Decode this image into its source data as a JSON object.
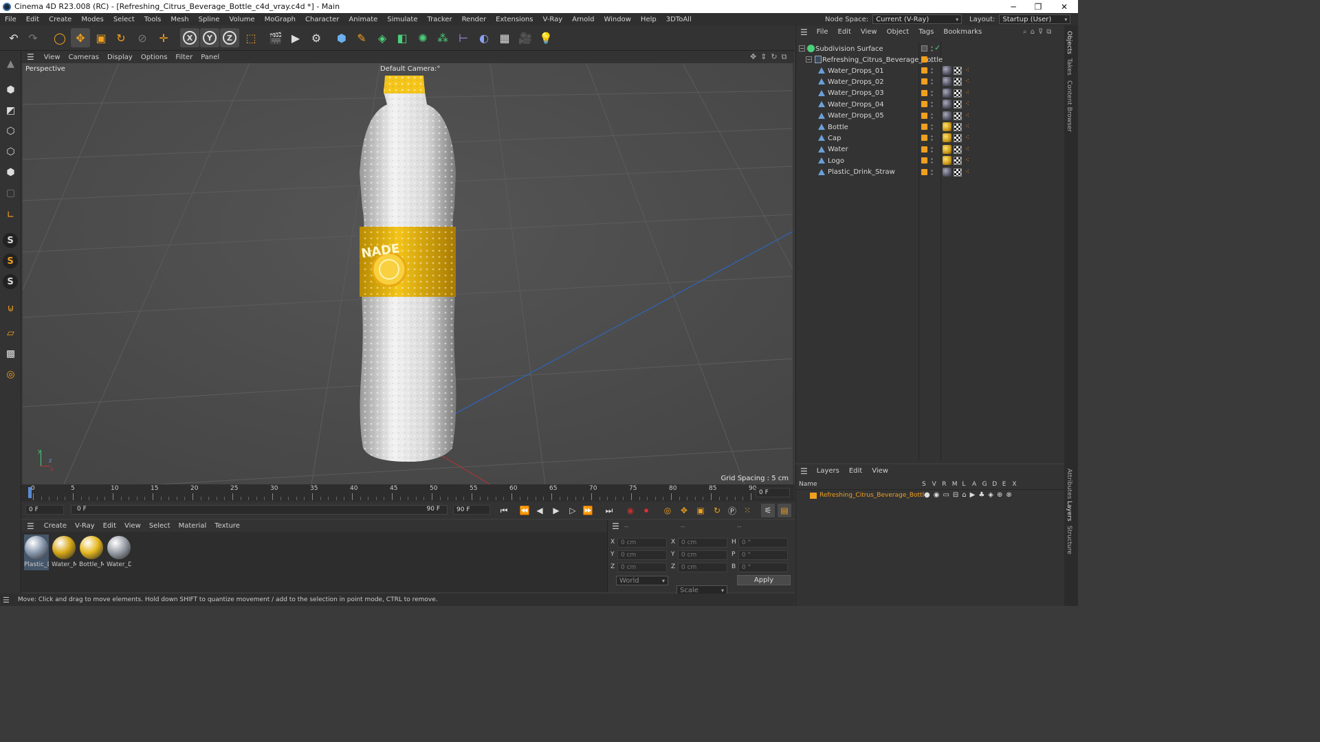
{
  "window": {
    "title": "Cinema 4D R23.008 (RC) - [Refreshing_Citrus_Beverage_Bottle_c4d_vray.c4d *] - Main",
    "minimize": "─",
    "maximize": "❐",
    "close": "✕"
  },
  "menu": [
    "File",
    "Edit",
    "Create",
    "Modes",
    "Select",
    "Tools",
    "Mesh",
    "Spline",
    "Volume",
    "MoGraph",
    "Character",
    "Animate",
    "Simulate",
    "Tracker",
    "Render",
    "Extensions",
    "V-Ray",
    "Arnold",
    "Window",
    "Help",
    "3DToAll"
  ],
  "header": {
    "node_space_label": "Node Space:",
    "node_space_value": "Current (V-Ray)",
    "layout_label": "Layout:",
    "layout_value": "Startup (User)"
  },
  "viewport": {
    "menu": [
      "View",
      "Cameras",
      "Display",
      "Options",
      "Filter",
      "Panel"
    ],
    "view_name": "Perspective",
    "camera": "Default Camera:°",
    "grid_spacing": "Grid Spacing : 5 cm",
    "label_text": "NADE",
    "axis": {
      "y": "y",
      "z": "z",
      "x": "x"
    }
  },
  "timeline": {
    "ticks": [
      "0",
      "5",
      "10",
      "15",
      "20",
      "25",
      "30",
      "35",
      "40",
      "45",
      "50",
      "55",
      "60",
      "65",
      "70",
      "75",
      "80",
      "85",
      "90"
    ],
    "end_field": "0 F"
  },
  "transport": {
    "start": "0 F",
    "range_start": "0 F",
    "range_end": "90 F",
    "end": "90 F"
  },
  "materials": {
    "menu": [
      "Create",
      "V-Ray",
      "Edit",
      "View",
      "Select",
      "Material",
      "Texture"
    ],
    "items": [
      {
        "name": "Plastic_D",
        "color": "#8a9ab0",
        "selected": true
      },
      {
        "name": "Water_M",
        "color": "#d8a818",
        "selected": false
      },
      {
        "name": "Bottle_M",
        "color": "#e6b820",
        "selected": false
      },
      {
        "name": "Water_D",
        "color": "#9aa0a8",
        "selected": false
      }
    ]
  },
  "coords": {
    "headers": [
      "--",
      "--",
      "--"
    ],
    "rows": [
      {
        "a": "X",
        "av": "0 cm",
        "b": "X",
        "bv": "0 cm",
        "c": "H",
        "cv": "0 °"
      },
      {
        "a": "Y",
        "av": "0 cm",
        "b": "Y",
        "bv": "0 cm",
        "c": "P",
        "cv": "0 °"
      },
      {
        "a": "Z",
        "av": "0 cm",
        "b": "Z",
        "bv": "0 cm",
        "c": "B",
        "cv": "0 °"
      }
    ],
    "space": "World",
    "mode": "Scale",
    "apply": "Apply"
  },
  "status": "Move: Click and drag to move elements. Hold down SHIFT to quantize movement / add to the selection in point mode, CTRL to remove.",
  "objects": {
    "menu": [
      "File",
      "Edit",
      "View",
      "Object",
      "Tags",
      "Bookmarks"
    ],
    "root": "Subdivision Surface",
    "group": "Refreshing_Citrus_Beverage_Bottle",
    "children": [
      {
        "name": "Water_Drops_01",
        "gold": false
      },
      {
        "name": "Water_Drops_02",
        "gold": false
      },
      {
        "name": "Water_Drops_03",
        "gold": false
      },
      {
        "name": "Water_Drops_04",
        "gold": false
      },
      {
        "name": "Water_Drops_05",
        "gold": false
      },
      {
        "name": "Bottle",
        "gold": true
      },
      {
        "name": "Cap",
        "gold": true
      },
      {
        "name": "Water",
        "gold": true
      },
      {
        "name": "Logo",
        "gold": true
      },
      {
        "name": "Plastic_Drink_Straw",
        "gold": false
      }
    ]
  },
  "layers": {
    "menu": [
      "Layers",
      "Edit",
      "View"
    ],
    "columns": [
      "Name",
      "S",
      "V",
      "R",
      "M",
      "L",
      "A",
      "G",
      "D",
      "E",
      "X"
    ],
    "items": [
      {
        "name": "Refreshing_Citrus_Beverage_Bottle",
        "color": "#f0a020"
      }
    ]
  },
  "right_tabs": [
    "Objects",
    "Takes",
    "Content Browser",
    "Attributes",
    "Layers",
    "Structure"
  ],
  "colors": {
    "accent_orange": "#f0a020",
    "viewport_bg": "#4b4b4b",
    "panel_bg": "#333333"
  }
}
